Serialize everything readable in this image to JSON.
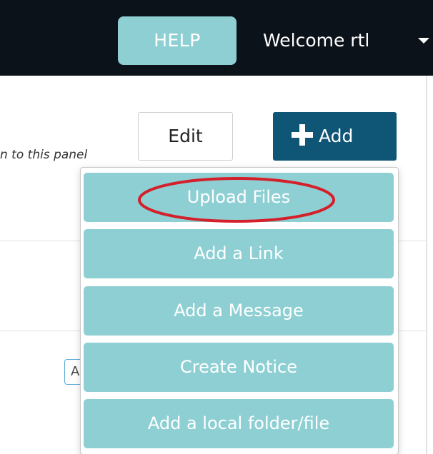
{
  "navbar": {
    "help_label": "HELP",
    "welcome_text": "Welcome rtl",
    "caret_icon": "caret-down-icon"
  },
  "panel": {
    "hint_text": "n to this panel",
    "edit_label": "Edit",
    "add_label": "Add",
    "add_icon": "plus-icon",
    "partial_button_text": "A"
  },
  "dropdown": {
    "items": [
      {
        "label": "Upload Files"
      },
      {
        "label": "Add a Link"
      },
      {
        "label": "Add a Message"
      },
      {
        "label": "Create Notice"
      },
      {
        "label": "Add a local folder/file"
      }
    ],
    "highlighted_item": "Upload Files"
  },
  "colors": {
    "navbar_bg": "#0c121a",
    "teal_button": "#8ecfd3",
    "add_button": "#0e5576",
    "highlight_ring": "#d4202a"
  }
}
